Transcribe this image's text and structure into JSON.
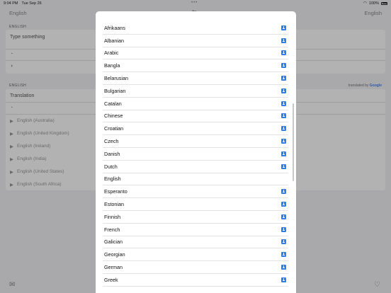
{
  "status": {
    "time": "9:04 PM",
    "date": "Tue Sep 26",
    "battery": "100%"
  },
  "nav": {
    "source_language": "English",
    "target_language": "English"
  },
  "input_section": {
    "label": "ENGLISH",
    "placeholder": "Type something"
  },
  "output_section": {
    "label": "ENGLISH",
    "text": "Translation",
    "credit_prefix": "translated by",
    "credit_brand": "Google",
    "voices": [
      "English (Australia)",
      "English (United Kingdom)",
      "English (Ireland)",
      "English (India)",
      "English (United States)",
      "English (South Africa)"
    ]
  },
  "languages": [
    {
      "name": "Afrikaans",
      "downloadable": true
    },
    {
      "name": "Albanian",
      "downloadable": true
    },
    {
      "name": "Arabic",
      "downloadable": true
    },
    {
      "name": "Bangla",
      "downloadable": true
    },
    {
      "name": "Belarusian",
      "downloadable": true
    },
    {
      "name": "Bulgarian",
      "downloadable": true
    },
    {
      "name": "Catalan",
      "downloadable": true
    },
    {
      "name": "Chinese",
      "downloadable": true
    },
    {
      "name": "Croatian",
      "downloadable": true
    },
    {
      "name": "Czech",
      "downloadable": true
    },
    {
      "name": "Danish",
      "downloadable": true
    },
    {
      "name": "Dutch",
      "downloadable": true
    },
    {
      "name": "English",
      "downloadable": false
    },
    {
      "name": "Esperanto",
      "downloadable": true
    },
    {
      "name": "Estonian",
      "downloadable": true
    },
    {
      "name": "Finnish",
      "downloadable": true
    },
    {
      "name": "French",
      "downloadable": true
    },
    {
      "name": "Galician",
      "downloadable": true
    },
    {
      "name": "Georgian",
      "downloadable": true
    },
    {
      "name": "German",
      "downloadable": true
    },
    {
      "name": "Greek",
      "downloadable": true
    }
  ],
  "colors": {
    "download_accent": "#2f7fe6",
    "google_blue": "#4285F4"
  },
  "icons": {
    "download": "download-icon",
    "swap": "swap-icon",
    "inbox": "inbox-icon",
    "settings": "gear-icon",
    "favorites": "heart-icon"
  }
}
